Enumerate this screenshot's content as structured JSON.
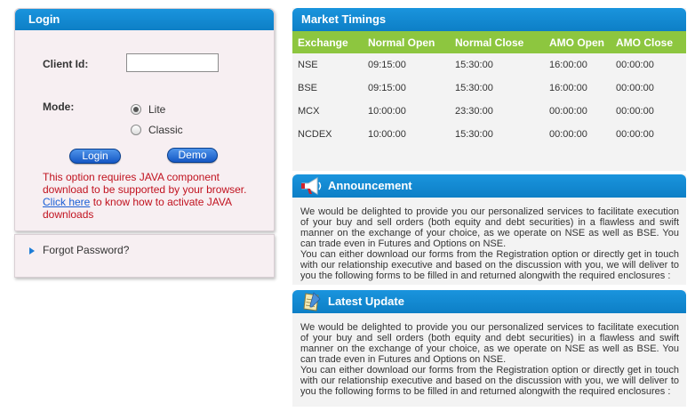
{
  "login": {
    "title": "Login",
    "client_id_label": "Client Id:",
    "client_id_value": "",
    "mode_label": "Mode:",
    "mode_options": [
      {
        "label": "Lite",
        "selected": true
      },
      {
        "label": "Classic",
        "selected": false
      }
    ],
    "login_button": "Login",
    "demo_button": "Demo",
    "java_message_part1": "This option requires JAVA component download to be supported by your browser.",
    "java_link": "Click here",
    "java_message_part2": " to know how to activate JAVA downloads"
  },
  "forgot": {
    "label": "Forgot Password?"
  },
  "market": {
    "title": "Market Timings",
    "columns": [
      "Exchange",
      "Normal Open",
      "Normal Close",
      "AMO Open",
      "AMO Close"
    ],
    "rows": [
      [
        "NSE",
        "09:15:00",
        "15:30:00",
        "16:00:00",
        "00:00:00"
      ],
      [
        "BSE",
        "09:15:00",
        "15:30:00",
        "16:00:00",
        "00:00:00"
      ],
      [
        "MCX",
        "10:00:00",
        "23:30:00",
        "00:00:00",
        "00:00:00"
      ],
      [
        "NCDEX",
        "10:00:00",
        "15:30:00",
        "00:00:00",
        "00:00:00"
      ]
    ]
  },
  "announcement": {
    "title": "Announcement",
    "text1": "We would be delighted to provide you our personalized services to facilitate execution of your buy and sell orders (both equity and debt securities) in a flawless and swift manner on the exchange of your choice, as we operate on NSE as well as BSE. You can trade even in Futures and Options on NSE.",
    "text2": "You can either download our forms from the Registration option or directly get in touch with our relationship executive and based on the discussion with you, we will deliver to you the following forms to be filled in and returned alongwith the required enclosures :"
  },
  "latest_update": {
    "title": "Latest Update",
    "text1": "We would be delighted to provide you our personalized services to facilitate execution of your buy and sell orders (both equity and debt securities) in a flawless and swift manner on the exchange of your choice, as we operate on NSE as well as BSE. You can trade even in Futures and Options on NSE.",
    "text2": "You can either download our forms from the Registration option or directly get in touch with our relationship executive and based on the discussion with you, we will deliver to you the following forms to be filled in and returned alongwith the required enclosures :"
  },
  "colors": {
    "header_blue": "#1a94dd",
    "table_header_green": "#8dc63f",
    "error_red": "#c1121f",
    "link_blue": "#1a5fd6"
  },
  "icons": {
    "announcement": "megaphone-icon",
    "latest_update": "notepad-icon",
    "forgot": "triangle-right-icon"
  }
}
